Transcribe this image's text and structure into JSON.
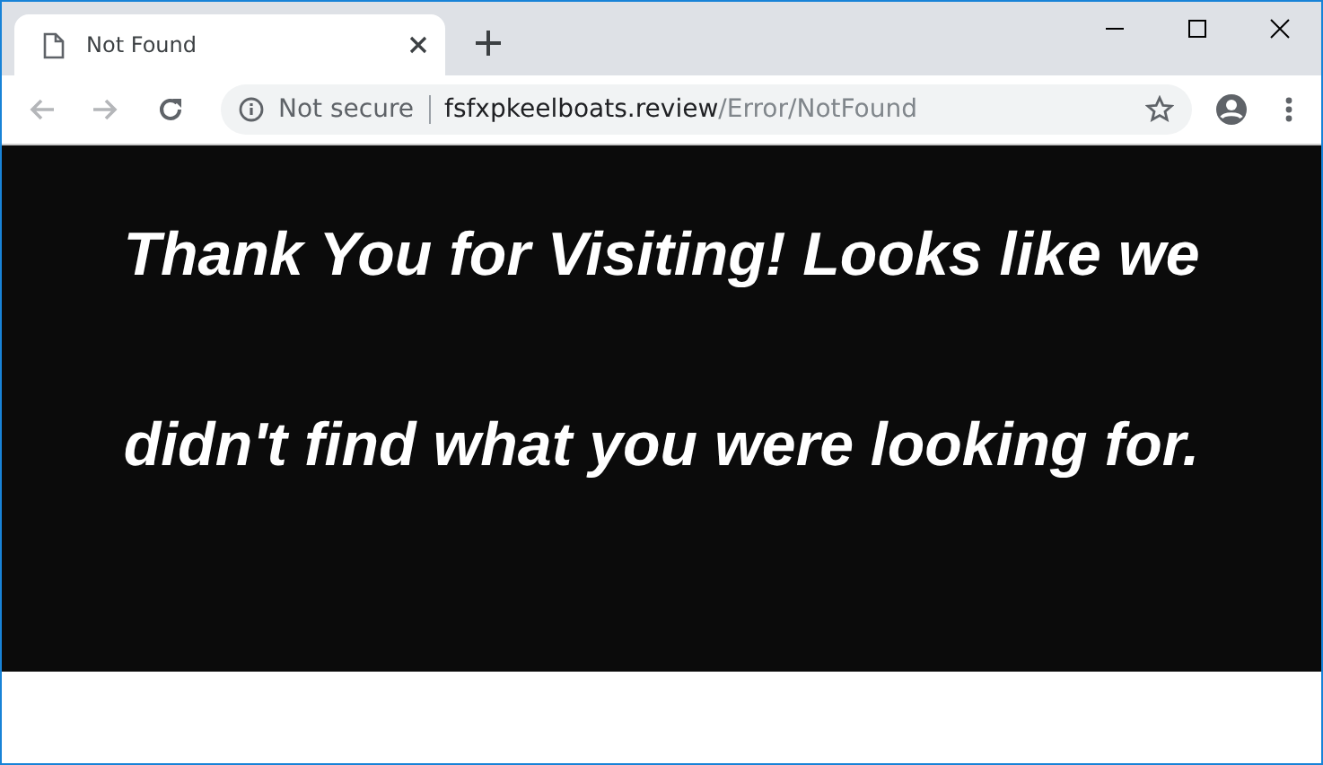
{
  "tab": {
    "title": "Not Found",
    "selected": true
  },
  "nav": [
    {
      "kind": "back",
      "disabled": true
    },
    {
      "kind": "forward",
      "disabled": true
    },
    {
      "kind": "reload",
      "disabled": false
    }
  ],
  "address": {
    "security": "Not secure",
    "host": "fsfxpkeelboats.review",
    "path": "/Error/NotFound"
  },
  "page": {
    "message": "Thank You for Visiting! Looks like we didn't find what you were looking for."
  }
}
